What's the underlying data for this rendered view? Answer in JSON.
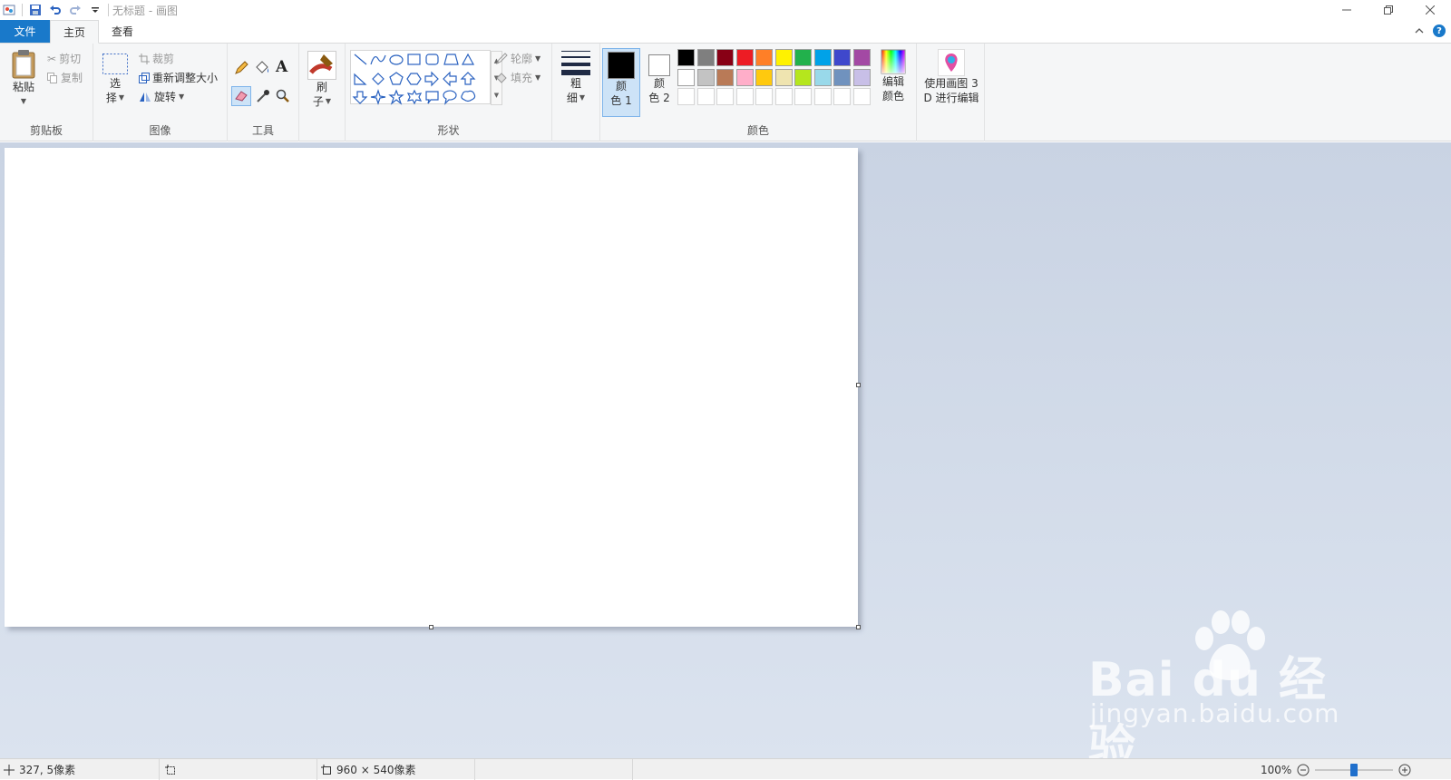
{
  "window": {
    "title": "无标题 - 画图"
  },
  "menu": {
    "file": "文件",
    "home": "主页",
    "view": "查看"
  },
  "clipboard": {
    "paste": "粘贴",
    "cut": "剪切",
    "copy": "复制",
    "group": "剪贴板"
  },
  "image": {
    "select_1": "选",
    "select_2": "择",
    "crop": "裁剪",
    "resize": "重新调整大小",
    "rotate": "旋转",
    "group": "图像"
  },
  "tools": {
    "group": "工具"
  },
  "brushes": {
    "label_1": "刷",
    "label_2": "子"
  },
  "shapes": {
    "outline": "轮廓",
    "fill": "填充",
    "group": "形状"
  },
  "size": {
    "label_1": "粗",
    "label_2": "细"
  },
  "colors": {
    "color1_1": "颜",
    "color1_2": "色 1",
    "color2_1": "颜",
    "color2_2": "色 2",
    "edit_1": "编辑",
    "edit_2": "颜色",
    "group": "颜色",
    "color1_value": "#000000",
    "color2_value": "#ffffff",
    "palette_row1": [
      "#000000",
      "#7f7f7f",
      "#880015",
      "#ed1c24",
      "#ff7f27",
      "#fff200",
      "#22b14c",
      "#00a2e8",
      "#3f48cc",
      "#a349a4"
    ],
    "palette_row2": [
      "#ffffff",
      "#c3c3c3",
      "#b97a57",
      "#ffaec9",
      "#ffc90e",
      "#efe4b0",
      "#b5e61d",
      "#99d9ea",
      "#7092be",
      "#c8bfe7"
    ]
  },
  "paint3d": {
    "label_1": "使用画图 3",
    "label_2": "D 进行编辑"
  },
  "status": {
    "cursor": "327, 5像素",
    "canvas_size": "960 × 540像素",
    "zoom": "100%",
    "zoom_fraction": 0.5
  },
  "watermark": {
    "brand": "Bai  du 经验",
    "url": "jingyan.baidu.com"
  }
}
